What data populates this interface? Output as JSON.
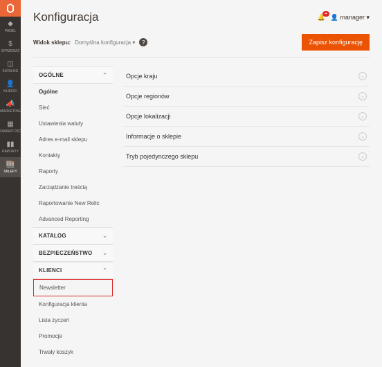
{
  "rail": {
    "items": [
      {
        "icon": "◆",
        "label": "PANEL"
      },
      {
        "icon": "$",
        "label": "SPRZEDAŻ"
      },
      {
        "icon": "◫",
        "label": "KATALOG"
      },
      {
        "icon": "👤",
        "label": "KLIENCI"
      },
      {
        "icon": "📣",
        "label": "MARKETING"
      },
      {
        "icon": "▦",
        "label": "ZAWARTOŚĆ"
      },
      {
        "icon": "▮▮",
        "label": "RAPORTY"
      },
      {
        "icon": "🏬",
        "label": "SKLEPY"
      }
    ],
    "active_index": 7
  },
  "header": {
    "title": "Konfiguracja",
    "notif_badge": "••",
    "user_label": "manager",
    "scope_label": "Widok sklepu:",
    "scope_value": "Domyślna konfiguracja",
    "save_label": "Zapisz konfigurację"
  },
  "sidebar": {
    "sections": [
      {
        "title": "OGÓLNE",
        "expanded": true,
        "items": [
          "Ogólne",
          "Sieć",
          "Ustawienia waluty",
          "Adres e-mail sklepu",
          "Kontakty",
          "Raporty",
          "Zarządzanie treścią",
          "Raportowanie New Relic",
          "Advanced Reporting"
        ],
        "active_index": 0
      },
      {
        "title": "KATALOG",
        "expanded": false
      },
      {
        "title": "BEZPIECZEŃSTWO",
        "expanded": false
      },
      {
        "title": "KLIENCI",
        "expanded": true,
        "items": [
          "Newsletter",
          "Konfiguracja klienta",
          "Lista życzeń",
          "Promocje",
          "Trwały koszyk"
        ],
        "highlight_index": 0
      }
    ]
  },
  "panel": {
    "rows": [
      "Opcje kraju",
      "Opcje regionów",
      "Opcje lokalizacji",
      "Informacje o sklepie",
      "Tryb pojedynczego sklepu"
    ]
  }
}
